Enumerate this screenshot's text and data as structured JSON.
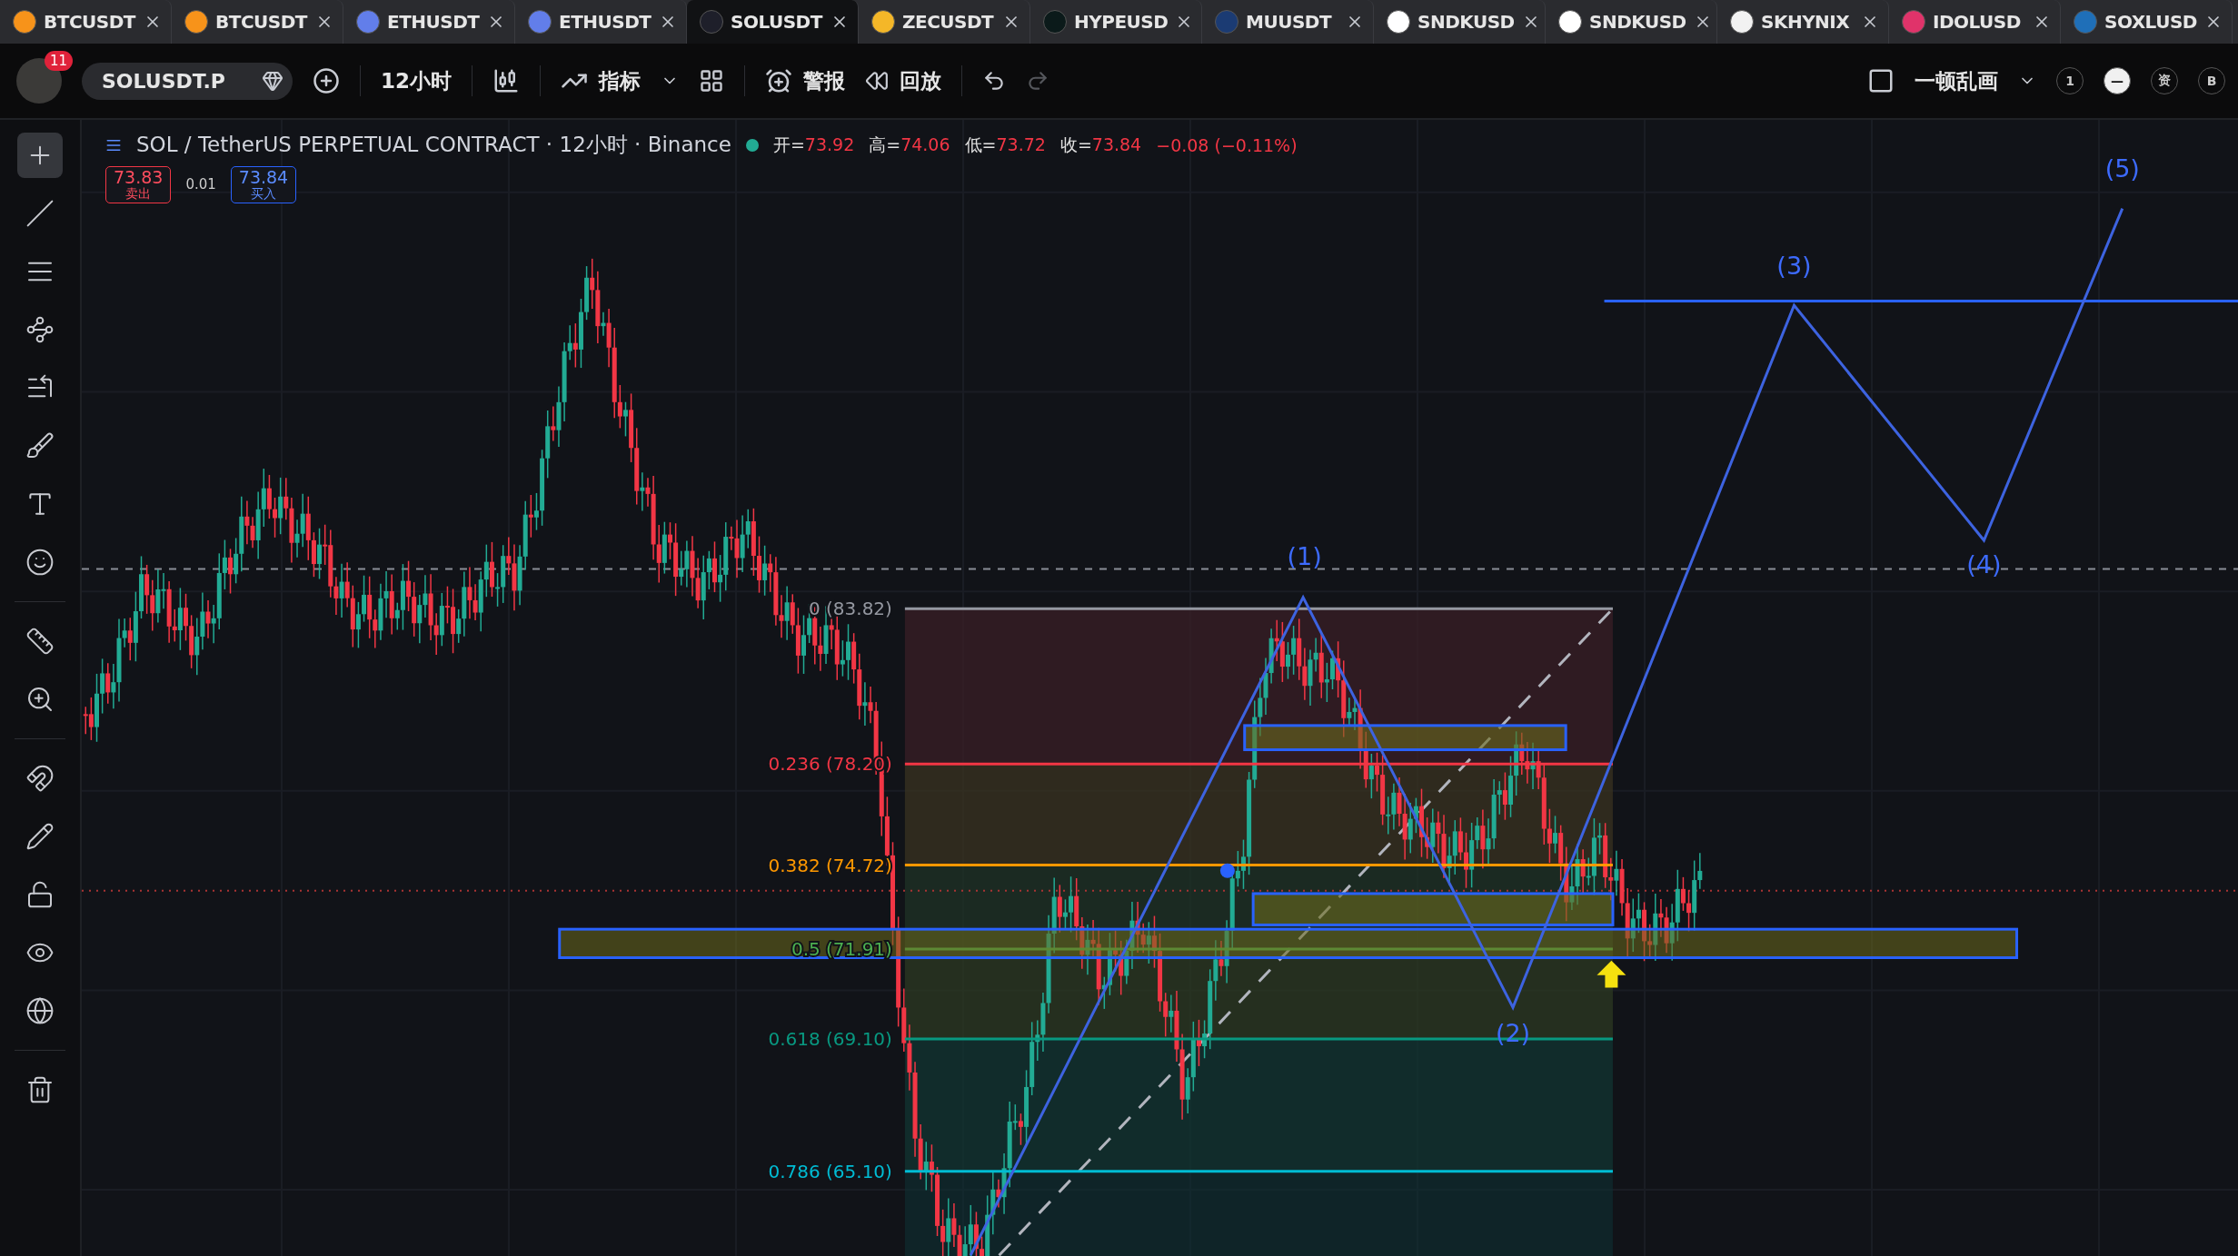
{
  "tabs": [
    {
      "label": "BTCUSDT",
      "color": "#f7931a",
      "selected": false
    },
    {
      "label": "BTCUSDT",
      "color": "#f7931a",
      "selected": false
    },
    {
      "label": "ETHUSDT",
      "color": "#627eea",
      "selected": false
    },
    {
      "label": "ETHUSDT",
      "color": "#627eea",
      "selected": false
    },
    {
      "label": "SOLUSDT",
      "color": "#1e1f2a",
      "selected": true
    },
    {
      "label": "ZECUSDT",
      "color": "#f4b728",
      "selected": false
    },
    {
      "label": "HYPEUSD",
      "color": "#0b1a1a",
      "selected": false
    },
    {
      "label": "MUUSDT",
      "color": "#1b3b73",
      "selected": false
    },
    {
      "label": "SNDKUSD",
      "color": "#ffffff",
      "selected": false
    },
    {
      "label": "SNDKUSD",
      "color": "#ffffff",
      "selected": false
    },
    {
      "label": "SKHYNIX",
      "color": "#f2f2f2",
      "selected": false
    },
    {
      "label": "IDOLUSD",
      "color": "#e0336a",
      "selected": false
    },
    {
      "label": "SOXLUSD",
      "color": "#1f6fb8",
      "selected": false
    }
  ],
  "toolbar": {
    "badge": "11",
    "symbol": "SOLUSDT.P",
    "interval": "12小时",
    "indicators": "指标",
    "alerts": "警报",
    "replay": "回放",
    "layout_name": "一顿乱画",
    "circles": [
      {
        "label": "1",
        "filled": false
      },
      {
        "label": "—",
        "filled": true
      },
      {
        "label": "资",
        "filled": false
      },
      {
        "label": "B",
        "filled": false
      }
    ]
  },
  "tool_groups": [
    [
      {
        "kind": "crosshair",
        "selected": true
      },
      {
        "kind": "trendline",
        "selected": false
      },
      {
        "kind": "channel",
        "selected": false
      },
      {
        "kind": "pattern",
        "selected": false
      },
      {
        "kind": "fib",
        "selected": false
      },
      {
        "kind": "brush",
        "selected": false
      },
      {
        "kind": "text",
        "selected": false
      },
      {
        "kind": "emoji",
        "selected": false
      }
    ],
    [
      {
        "kind": "ruler",
        "selected": false
      },
      {
        "kind": "zoom",
        "selected": false
      }
    ],
    [
      {
        "kind": "magnet",
        "selected": false
      },
      {
        "kind": "lockdraw",
        "selected": false
      },
      {
        "kind": "lock",
        "selected": false
      },
      {
        "kind": "eye",
        "selected": false
      },
      {
        "kind": "globe",
        "selected": false
      }
    ],
    [
      {
        "kind": "trash",
        "selected": false
      }
    ]
  ],
  "legend": {
    "title": "SOL / TetherUS PERPETUAL CONTRACT · 12小时 · Binance",
    "ohlc": [
      {
        "label": "开=",
        "value": "73.92"
      },
      {
        "label": "高=",
        "value": "74.06"
      },
      {
        "label": "低=",
        "value": "73.72"
      },
      {
        "label": "收=",
        "value": "73.84"
      }
    ],
    "change": "−0.08 (−0.11%)",
    "sell": {
      "price": "73.83",
      "label": "卖出"
    },
    "spread": "0.01",
    "buy": {
      "price": "73.84",
      "label": "买入"
    }
  },
  "chart": {
    "fib_levels": [
      {
        "label": "0 (83.82)",
        "color": "#9598a1"
      },
      {
        "label": "0.236 (78.20)",
        "color": "#f23645"
      },
      {
        "label": "0.382 (74.72)",
        "color": "#ff9800"
      },
      {
        "label": "0.5 (71.91)",
        "color": "#4caf50"
      },
      {
        "label": "0.618 (69.10)",
        "color": "#089981"
      },
      {
        "label": "0.786 (65.10)",
        "color": "#00bcd4"
      }
    ],
    "wave_labels": [
      "(1)",
      "(2)",
      "(3)",
      "(4)",
      "(5)"
    ]
  }
}
